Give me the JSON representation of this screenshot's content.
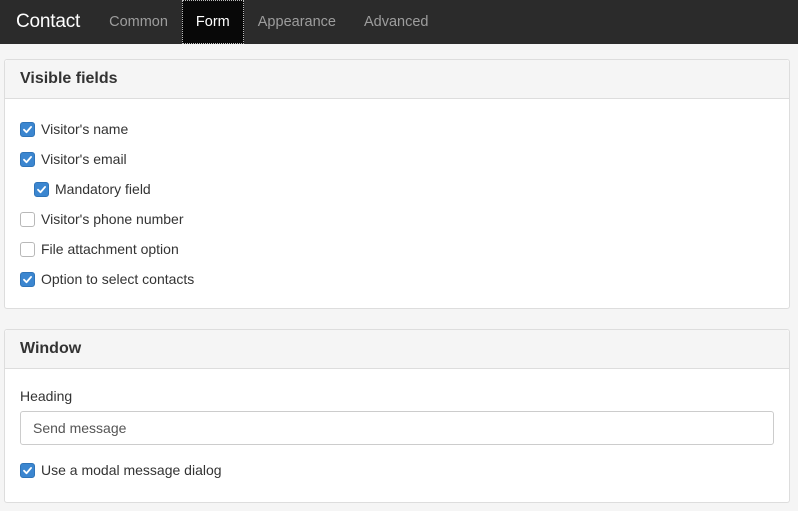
{
  "navbar": {
    "brand": "Contact",
    "tabs": [
      {
        "label": "Common",
        "active": false
      },
      {
        "label": "Form",
        "active": true
      },
      {
        "label": "Appearance",
        "active": false
      },
      {
        "label": "Advanced",
        "active": false
      }
    ]
  },
  "visible_fields": {
    "title": "Visible fields",
    "options": [
      {
        "label": "Visitor's name",
        "checked": true,
        "indented": false
      },
      {
        "label": "Visitor's email",
        "checked": true,
        "indented": false
      },
      {
        "label": "Mandatory field",
        "checked": true,
        "indented": true
      },
      {
        "label": "Visitor's phone number",
        "checked": false,
        "indented": false
      },
      {
        "label": "File attachment option",
        "checked": false,
        "indented": false
      },
      {
        "label": "Option to select contacts",
        "checked": true,
        "indented": false
      }
    ]
  },
  "window": {
    "title": "Window",
    "heading_label": "Heading",
    "heading_value": "Send message",
    "modal_label": "Use a modal message dialog",
    "modal_checked": true
  },
  "colors": {
    "navbar_bg": "#2b2b2b",
    "active_tab_bg": "#080808",
    "checkbox_on": "#3b86d0"
  }
}
